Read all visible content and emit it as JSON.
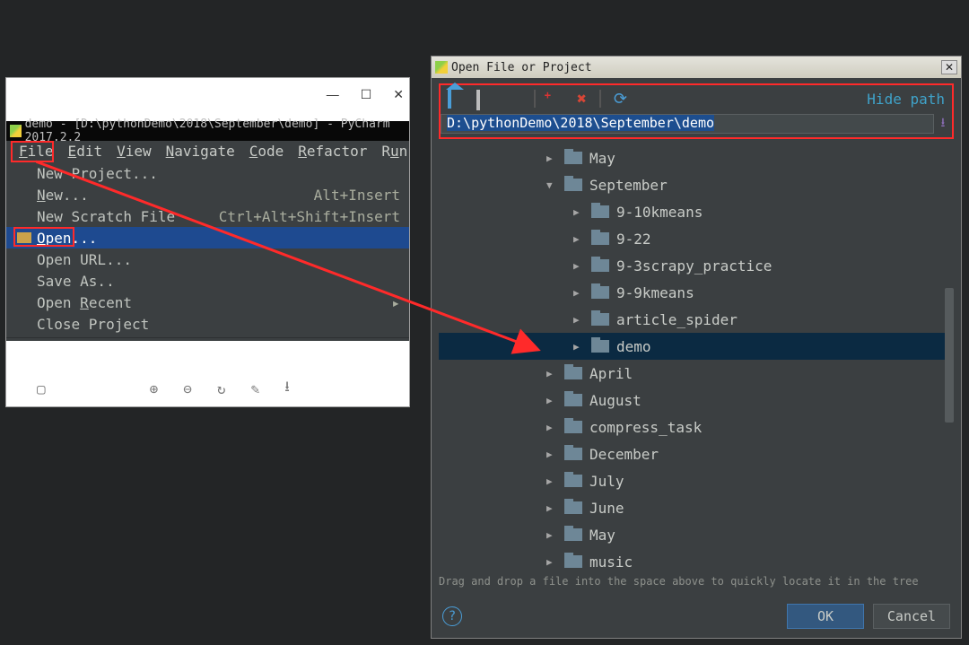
{
  "pycharm": {
    "title": "demo - [D:\\pythonDemo\\2018\\September\\demo] - PyCharm 2017.2.2",
    "menus": {
      "file": "File",
      "edit": "Edit",
      "view": "View",
      "navigate": "Navigate",
      "code": "Code",
      "refactor": "Refactor",
      "run": "Run"
    },
    "win_btns": {
      "min": "—",
      "max": "☐",
      "close": "✕"
    }
  },
  "file_menu": {
    "new_project": "New Project...",
    "new": "New...",
    "new_sc": "Alt+Insert",
    "scratch": "New Scratch File",
    "scratch_sc": "Ctrl+Alt+Shift+Insert",
    "open": "Open...",
    "open_url": "Open URL...",
    "save_as": "Save As..",
    "open_recent": "Open Recent",
    "close_project": "Close Project"
  },
  "dialog": {
    "title": "Open File or Project",
    "hide_path": "Hide path",
    "path": "D:\\pythonDemo\\2018\\September\\demo",
    "hint": "Drag and drop a file into the space above to quickly locate it in the tree",
    "ok": "OK",
    "cancel": "Cancel"
  },
  "tree": {
    "nodes": [
      {
        "depth": 2,
        "arrow": "▶",
        "label": "May",
        "selected": false
      },
      {
        "depth": 2,
        "arrow": "▼",
        "label": "September",
        "selected": false
      },
      {
        "depth": 3,
        "arrow": "▶",
        "label": "9-10kmeans",
        "selected": false
      },
      {
        "depth": 3,
        "arrow": "▶",
        "label": "9-22",
        "selected": false
      },
      {
        "depth": 3,
        "arrow": "▶",
        "label": "9-3scrapy_practice",
        "selected": false
      },
      {
        "depth": 3,
        "arrow": "▶",
        "label": "9-9kmeans",
        "selected": false
      },
      {
        "depth": 3,
        "arrow": "▶",
        "label": "article_spider",
        "selected": false
      },
      {
        "depth": 3,
        "arrow": "▶",
        "label": "demo",
        "selected": true
      },
      {
        "depth": 2,
        "arrow": "▶",
        "label": "April",
        "selected": false
      },
      {
        "depth": 2,
        "arrow": "▶",
        "label": "August",
        "selected": false
      },
      {
        "depth": 2,
        "arrow": "▶",
        "label": "compress_task",
        "selected": false
      },
      {
        "depth": 2,
        "arrow": "▶",
        "label": "December",
        "selected": false
      },
      {
        "depth": 2,
        "arrow": "▶",
        "label": "July",
        "selected": false
      },
      {
        "depth": 2,
        "arrow": "▶",
        "label": "June",
        "selected": false
      },
      {
        "depth": 2,
        "arrow": "▶",
        "label": "May",
        "selected": false
      },
      {
        "depth": 2,
        "arrow": "▶",
        "label": "music",
        "selected": false
      }
    ]
  }
}
